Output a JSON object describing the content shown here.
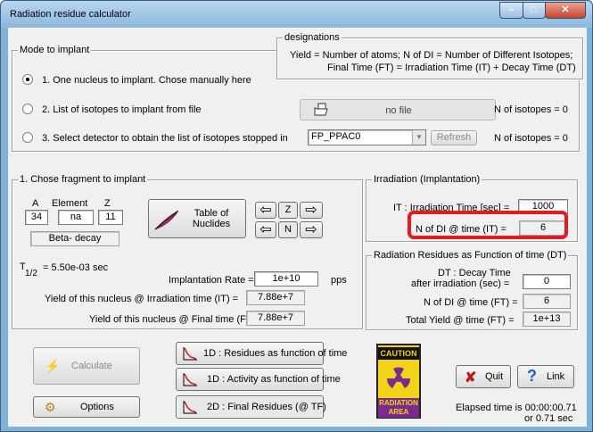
{
  "window": {
    "title": "Radiation residue calculator",
    "minimize": "–",
    "maximize": "□",
    "close": "✕"
  },
  "designations": {
    "legend": "designations",
    "line1": "Yield = Number of atoms;     N of DI = Number of Different Isotopes;",
    "line2": "Final Time (FT) = Irradiation Time (IT) +  Decay Time (DT)"
  },
  "mode": {
    "legend": "Mode to implant",
    "option1": "1. One nucleus to implant. Chose manually here",
    "option2": "2. List of isotopes to implant from file",
    "option3": "3. Select detector to obtain the list of isotopes stopped  in",
    "file_button": "no file",
    "n_isotopes_file": "N of isotopes = 0",
    "detector_value": "FP_PPAC0",
    "refresh_label": "Refresh",
    "n_isotopes_detector": "N of isotopes = 0"
  },
  "fragment": {
    "legend": "1.  Chose fragment to implant",
    "a_label": "A",
    "element_label": "Element",
    "z_label": "Z",
    "a_value": "34",
    "element_value": "na",
    "z_value": "11",
    "decay_mode": "Beta- decay",
    "table_button": "Table of\nNuclides",
    "z_button": "Z",
    "n_button": "N",
    "half_life_t": "T",
    "half_life_sub": "1/2",
    "half_life_text": "=   5.50e-03  sec",
    "rate_label": "Implantation Rate =",
    "rate_value": "1e+10",
    "rate_unit": "pps",
    "yield_it_label": "Yield of this nucleus @  Irradiation time (IT) =",
    "yield_it_value": "7.88e+7",
    "yield_ft_label": "Yield of this nucleus @ Final time (FT) =",
    "yield_ft_value": "7.88e+7"
  },
  "irradiation": {
    "legend": "Irradiation (Implantation)",
    "time_label": "IT : Irradiation Time  [sec] =",
    "time_value": "1000",
    "ndi_label": "N of DI  @ time (IT) =",
    "ndi_value": "6"
  },
  "residues": {
    "legend": "Radiation Residues as Function of time (DT)",
    "decay_label1": "DT : Decay Time",
    "decay_label2": "after irradiation (sec) =",
    "decay_value": "0",
    "ndi_label": "N of DI  @ time (FT) =",
    "ndi_value": "6",
    "total_label": "Total Yield  @ time (FT) =",
    "total_value": "1e+13"
  },
  "buttons": {
    "calculate": "Calculate",
    "options": "Options",
    "residues_1d": "1D : Residues as function of time",
    "activity_1d": "1D : Activity as function of time",
    "final_2d": "2D : Final Residues (@ TF)",
    "quit": "Quit",
    "link": "Link"
  },
  "caution": {
    "top": "CAUTION",
    "bottom": "RADIATION\nAREA"
  },
  "elapsed": {
    "line1": "Elapsed time is 00:00:00.71",
    "line2": "or 0.71 sec"
  },
  "colors": {
    "highlight": "#e31b23",
    "caution_yellow": "#f3d21a",
    "trefoil": "#7a2b8e"
  }
}
